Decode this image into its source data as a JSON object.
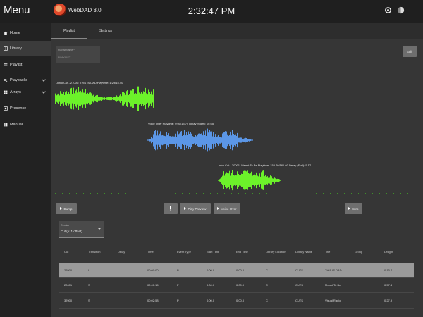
{
  "topbar": {
    "menu_label": "Menu",
    "app_title": "WebDAD 3.0",
    "clock": "2:32:47 PM",
    "icons": [
      "settings-gear-icon",
      "contrast-icon",
      "moon-icon"
    ]
  },
  "sidebar": {
    "items": [
      {
        "label": "Home",
        "icon": "home-icon"
      },
      {
        "label": "Library",
        "icon": "book-icon"
      },
      {
        "label": "Playlist",
        "icon": "list-icon"
      },
      {
        "label": "Playbacks",
        "icon": "playlist-icon"
      },
      {
        "label": "Arrays",
        "icon": "grid-icon"
      },
      {
        "label": "Presence",
        "icon": "presence-icon"
      },
      {
        "label": "Manual",
        "icon": "manual-icon"
      }
    ]
  },
  "tabs": [
    {
      "label": "Playlist",
      "active": true
    },
    {
      "label": "Settings",
      "active": false
    }
  ],
  "playlist_name": {
    "label": "Playlist Name *",
    "value": "PLAYLIST"
  },
  "buttons": {
    "edit": "Edit",
    "dump": "Dump",
    "play_preview": "Play Preview",
    "voice_over": "Voice Over",
    "intro": "Intro"
  },
  "waveforms": [
    {
      "label": "Outro Cut - 27000: THIS IS DAD    Playtime: 1:29/15.40",
      "color": "#6cf22a"
    },
    {
      "label": "Voice Over    Playtime: 0:00/13.74    Delay (Start): 10.65",
      "color": "#5b96e6"
    },
    {
      "label": "Intro Cut - 20001: Meant To Be    Playtime: 155.20/161.60    Delay (End): 5.17",
      "color": "#6cf22a"
    }
  ],
  "overlap_select": {
    "label": "Overlap",
    "value": "Cut (+11 offset)"
  },
  "table": {
    "headers": [
      "Cut",
      "Transition",
      "Delay",
      "Time",
      "Event Type",
      "Start Time",
      "End Time",
      "Library Location",
      "Library Name",
      "Title",
      "Group",
      "Length"
    ],
    "rows": [
      [
        "27000",
        "L",
        "",
        "00:00:00",
        "P",
        "0:00.0",
        "0:00.0",
        "C",
        "CUTS",
        "THIS IS DAD",
        "",
        "0:13.7"
      ],
      [
        "20001",
        "S",
        "",
        "00:00:15",
        "P",
        "0:00.0",
        "0:00.0",
        "C",
        "CUTS",
        "Meant To Be",
        "",
        "0:57.4"
      ],
      [
        "37000",
        "S",
        "",
        "00:02:58",
        "P",
        "0:00.0",
        "0:00.0",
        "C",
        "CUTS",
        "Visual Radio",
        "",
        "0:27.9"
      ]
    ],
    "selected_row": 0
  },
  "colors": {
    "waveform_green": "#6cf22a",
    "waveform_blue": "#5b96e6",
    "accent": "#6e6e6e"
  }
}
